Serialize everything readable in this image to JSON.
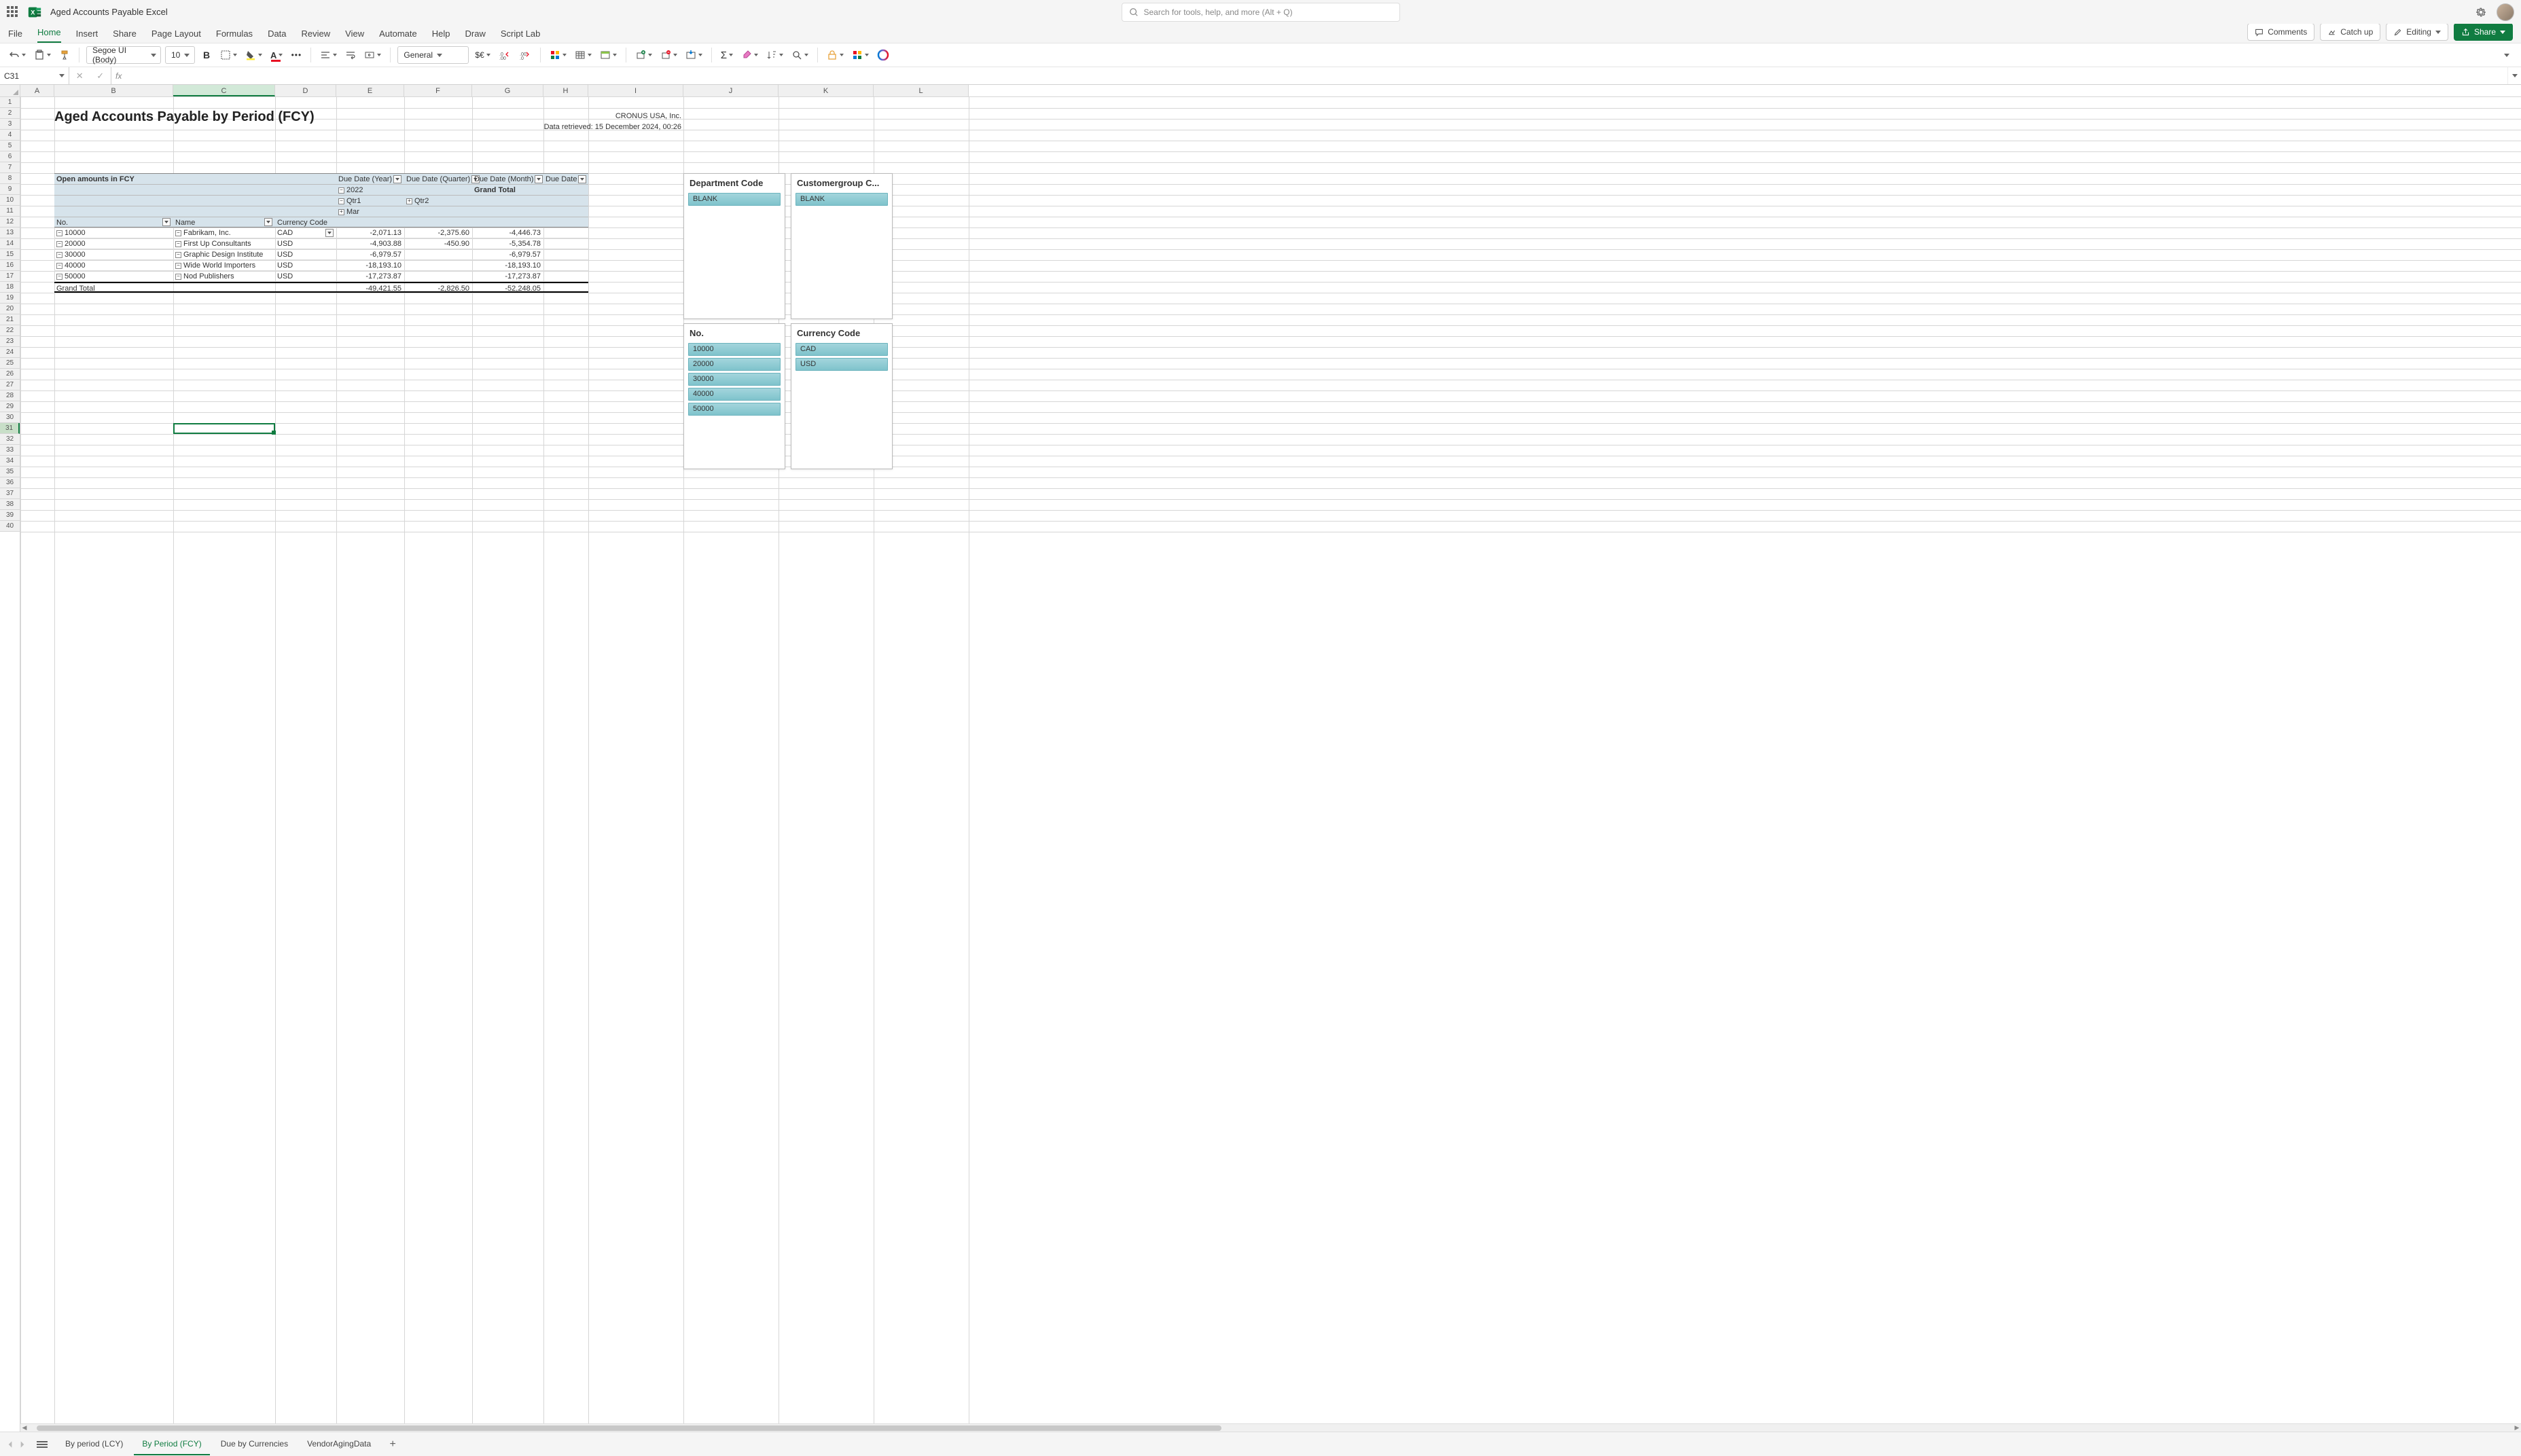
{
  "app": {
    "doc_title": "Aged Accounts Payable Excel",
    "search_placeholder": "Search for tools, help, and more (Alt + Q)"
  },
  "menu": {
    "items": [
      "File",
      "Home",
      "Insert",
      "Share",
      "Page Layout",
      "Formulas",
      "Data",
      "Review",
      "View",
      "Automate",
      "Help",
      "Draw",
      "Script Lab"
    ],
    "active": "Home",
    "comments": "Comments",
    "catch_up": "Catch up",
    "editing": "Editing",
    "share": "Share"
  },
  "ribbon": {
    "font_name": "Segoe UI (Body)",
    "font_size": "10",
    "number_format": "General"
  },
  "formula_bar": {
    "cell_ref": "C31",
    "formula": ""
  },
  "columns": [
    "A",
    "B",
    "C",
    "D",
    "E",
    "F",
    "G",
    "H",
    "I",
    "J",
    "K",
    "L"
  ],
  "report": {
    "title": "Aged Accounts Payable by Period (FCY)",
    "company": "CRONUS USA, Inc.",
    "retrieved": "Data retrieved: 15 December 2024, 00:26"
  },
  "pivot": {
    "corner": "Open amounts in FCY",
    "col_fields": [
      {
        "label": "Due Date (Year)"
      },
      {
        "label": "Due Date (Quarter)"
      },
      {
        "label": "Due Date (Month)"
      },
      {
        "label": "Due Date"
      }
    ],
    "year": "2022",
    "qtr1": "Qtr1",
    "qtr2": "Qtr2",
    "month": "Mar",
    "grand_total_col": "Grand Total",
    "row_fields": [
      {
        "label": "No."
      },
      {
        "label": "Name"
      },
      {
        "label": "Currency Code"
      }
    ],
    "rows": [
      {
        "no": "10000",
        "name": "Fabrikam, Inc.",
        "ccy": "CAD",
        "v1": "-2,071.13",
        "v2": "-2,375.60",
        "gt": "-4,446.73"
      },
      {
        "no": "20000",
        "name": "First Up Consultants",
        "ccy": "USD",
        "v1": "-4,903.88",
        "v2": "-450.90",
        "gt": "-5,354.78"
      },
      {
        "no": "30000",
        "name": "Graphic Design Institute",
        "ccy": "USD",
        "v1": "-6,979.57",
        "v2": "",
        "gt": "-6,979.57"
      },
      {
        "no": "40000",
        "name": "Wide World Importers",
        "ccy": "USD",
        "v1": "-18,193.10",
        "v2": "",
        "gt": "-18,193.10"
      },
      {
        "no": "50000",
        "name": "Nod Publishers",
        "ccy": "USD",
        "v1": "-17,273.87",
        "v2": "",
        "gt": "-17,273.87"
      }
    ],
    "grand_total_row": {
      "label": "Grand Total",
      "v1": "-49,421.55",
      "v2": "-2,826.50",
      "gt": "-52,248.05"
    }
  },
  "slicers": [
    {
      "title": "Department Code",
      "items": [
        "BLANK"
      ]
    },
    {
      "title": "Customergroup C...",
      "items": [
        "BLANK"
      ]
    },
    {
      "title": "No.",
      "items": [
        "10000",
        "20000",
        "30000",
        "40000",
        "50000"
      ]
    },
    {
      "title": "Currency Code",
      "items": [
        "CAD",
        "USD"
      ]
    }
  ],
  "sheets": {
    "tabs": [
      "By period (LCY)",
      "By Period (FCY)",
      "Due by Currencies",
      "VendorAgingData"
    ],
    "active": "By Period (FCY)"
  }
}
